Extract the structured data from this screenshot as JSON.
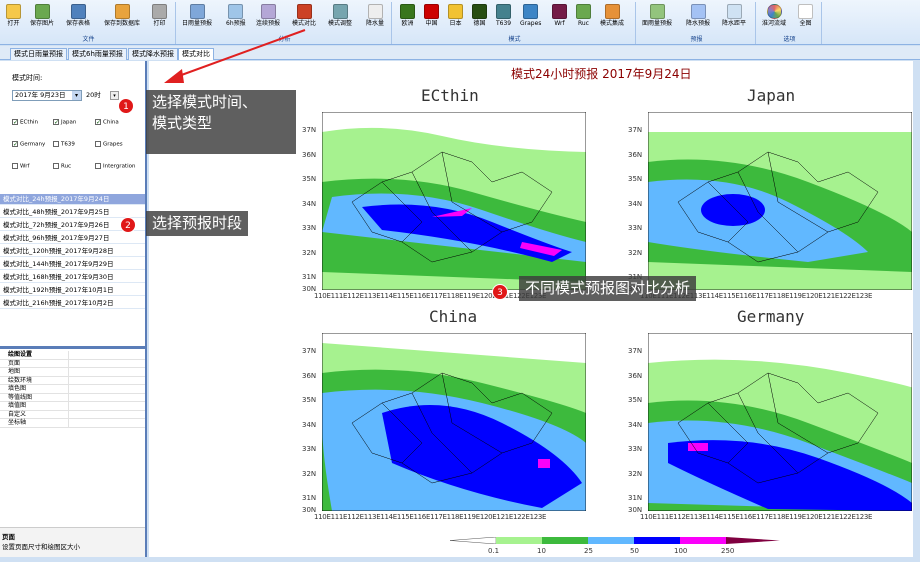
{
  "ribbon": {
    "groups": [
      {
        "label": "文件",
        "buttons": [
          "打开",
          "保存图片",
          "保存表格",
          "保存到数据库",
          "打印"
        ]
      },
      {
        "label": "分析",
        "buttons": [
          "日雨量预报",
          "6h预报",
          "连续预报",
          "模式对比",
          "模式调整",
          "降水量"
        ]
      },
      {
        "label": "模式",
        "buttons": [
          "欧洲",
          "中国",
          "日本",
          "德国",
          "T639",
          "Grapes",
          "Wrf",
          "Ruc",
          "模式集成"
        ]
      },
      {
        "label": "预报",
        "buttons": [
          "面雨量预报",
          "降水预报",
          "降水距平"
        ]
      },
      {
        "label": "选项",
        "buttons": [
          "淮河流域",
          "全图"
        ]
      }
    ]
  },
  "tabs": [
    "模式日雨量预报",
    "模式6h雨量预报",
    "模式降水预报",
    "模式对比"
  ],
  "left": {
    "time_label": "模式时间:",
    "date_value": "2017年 9月23日",
    "hour_value": "20时",
    "models": [
      "ECthin",
      "Japan",
      "China",
      "Germany",
      "T639",
      "Grapes",
      "Wrf",
      "Ruc",
      "Intergration"
    ],
    "models_checked": [
      true,
      true,
      true,
      true,
      false,
      false,
      false,
      false,
      false
    ],
    "periods": [
      "模式对比_24h预报_2017年9月24日",
      "模式对比_48h预报_2017年9月25日",
      "模式对比_72h预报_2017年9月26日",
      "模式对比_96h预报_2017年9月27日",
      "模式对比_120h预报_2017年9月28日",
      "模式对比_144h预报_2017年9月29日",
      "模式对比_168h预报_2017年9月30日",
      "模式对比_192h预报_2017年10月1日",
      "模式对比_216h预报_2017年10月2日"
    ],
    "props_title": "绘图设置",
    "props": [
      "页面",
      "地图",
      "绘数环境",
      "填色图",
      "等值线图",
      "填值图",
      "自定义",
      "坐标轴"
    ],
    "desc_title": "页面",
    "desc_text": "设置页面尺寸和绘图区大小"
  },
  "main": {
    "title": "模式24小时预报  2017年9月24日",
    "panels": [
      {
        "name": "ECthin"
      },
      {
        "name": "Japan"
      },
      {
        "name": "China"
      },
      {
        "name": "Germany"
      }
    ],
    "y_ticks": [
      "37N",
      "36N",
      "35N",
      "34N",
      "33N",
      "32N",
      "31N",
      "30N"
    ],
    "x_ticks": "110E111E112E113E114E115E116E117E118E119E120E121E122E123E",
    "colorbar": {
      "labels": [
        "0.1",
        "10",
        "25",
        "50",
        "100",
        "250"
      ],
      "colors": [
        "#ffffff",
        "#a6f28f",
        "#3dba3d",
        "#61b8ff",
        "#0000ff",
        "#fa00fa",
        "#800040"
      ]
    }
  },
  "callouts": [
    {
      "num": "1",
      "text": "选择模式时间、模式类型"
    },
    {
      "num": "2",
      "text": "选择预报时段"
    },
    {
      "num": "3",
      "text": "不同模式预报图对比分析"
    }
  ],
  "callout_lines": [
    "选择模式时间、",
    "模式类型"
  ]
}
